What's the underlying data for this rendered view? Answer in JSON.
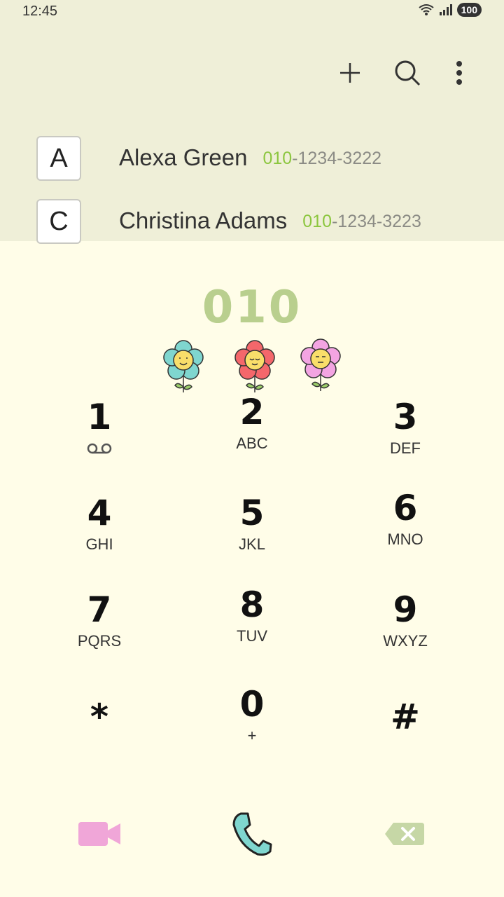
{
  "status": {
    "time": "12:45",
    "battery": "100"
  },
  "toolbar": {
    "add_icon": "plus-icon",
    "search_icon": "search-icon",
    "more_icon": "more-vert-icon"
  },
  "contacts": [
    {
      "letter": "A",
      "name": "Alexa Green",
      "num_prefix": "010",
      "num_rest": "-1234-3222"
    },
    {
      "letter": "C",
      "name": "Christina Adams",
      "num_prefix": "010",
      "num_rest": "-1234-3223"
    }
  ],
  "dialer": {
    "entered": "010",
    "keys": [
      {
        "digit": "1",
        "letters": ""
      },
      {
        "digit": "2",
        "letters": "ABC"
      },
      {
        "digit": "3",
        "letters": "DEF"
      },
      {
        "digit": "4",
        "letters": "GHI"
      },
      {
        "digit": "5",
        "letters": "JKL"
      },
      {
        "digit": "6",
        "letters": "MNO"
      },
      {
        "digit": "7",
        "letters": "PQRS"
      },
      {
        "digit": "8",
        "letters": "TUV"
      },
      {
        "digit": "9",
        "letters": "WXYZ"
      },
      {
        "digit": "*",
        "letters": ""
      },
      {
        "digit": "0",
        "letters": "+"
      },
      {
        "digit": "#",
        "letters": ""
      }
    ]
  },
  "colors": {
    "accent_green": "#8cc63f",
    "dialed_text": "#b9cf8e",
    "video": "#f0a6d8",
    "call": "#7fd6cf",
    "backspace": "#c6d7a6"
  }
}
